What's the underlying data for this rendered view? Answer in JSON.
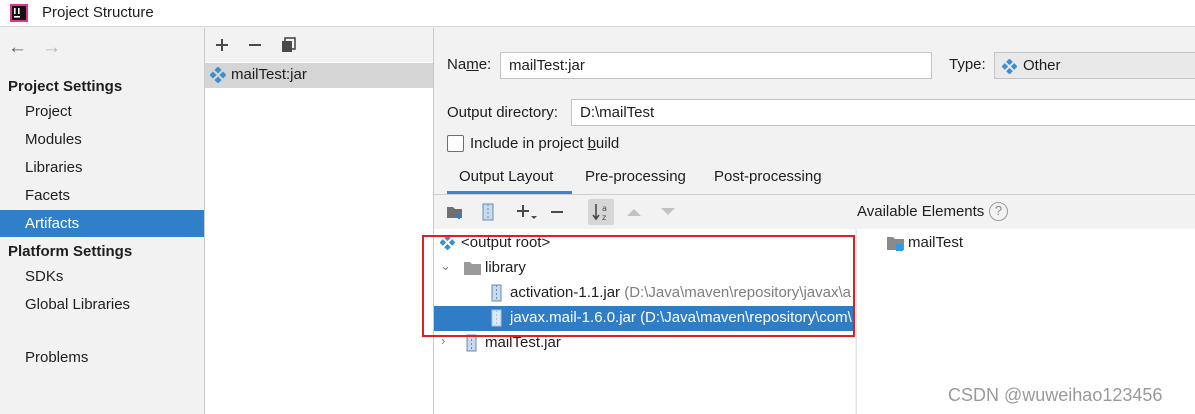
{
  "window": {
    "title": "Project Structure"
  },
  "nav": {
    "back_icon": "arrow-left-icon",
    "forward_icon": "arrow-right-icon",
    "project_settings_header": "Project Settings",
    "project_settings": [
      "Project",
      "Modules",
      "Libraries",
      "Facets",
      "Artifacts"
    ],
    "platform_settings_header": "Platform Settings",
    "platform_settings": [
      "SDKs",
      "Global Libraries"
    ],
    "problems": "Problems",
    "selected": "Artifacts"
  },
  "artifacts": {
    "toolbar_icons": [
      "add-icon",
      "remove-icon",
      "copy-icon"
    ],
    "items": [
      {
        "name": "mailTest:jar"
      }
    ]
  },
  "config": {
    "name_label_pre": "Na",
    "name_label_underlined": "m",
    "name_label_post": "e:",
    "name_value": "mailTest:jar",
    "type_label": "Type:",
    "type_value": "Other",
    "output_dir_label": "Output directory:",
    "output_dir_value": "D:\\mailTest",
    "include_pre": "Include in project ",
    "include_underlined": "b",
    "include_post": "uild",
    "include_checked": false,
    "tabs": [
      "Output Layout",
      "Pre-processing",
      "Post-processing"
    ],
    "active_tab": "Output Layout",
    "available_label": "Available Elements",
    "help_glyph": "?"
  },
  "tree": {
    "root": "<output root>",
    "library": "library",
    "jars": [
      {
        "name": "activation-1.1.jar",
        "path": "(D:\\Java\\maven\\repository\\javax\\a"
      },
      {
        "name": "javax.mail-1.6.0.jar",
        "path": "(D:\\Java\\maven\\repository\\com\\"
      }
    ],
    "module_jar": "mailTest.jar",
    "selected": "javax.mail-1.6.0.jar"
  },
  "available": {
    "items": [
      {
        "name": "mailTest"
      }
    ]
  },
  "watermark": "CSDN @wuweihao123456",
  "colors": {
    "selection": "#2f80c9",
    "highlight_box": "#e02020",
    "artifact_icon": "#3d8fd1"
  }
}
